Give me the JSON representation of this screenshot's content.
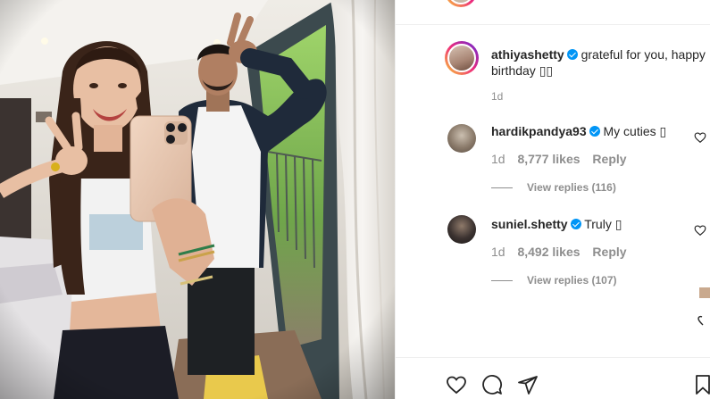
{
  "caption": {
    "username": "athiyashetty",
    "text_line1": "grateful for you, happy",
    "text_line2": "birthday ▯▯",
    "time": "1d"
  },
  "comments": [
    {
      "username": "hardikpandya93",
      "text": "My cuties ▯",
      "time": "1d",
      "likes": "8,777 likes",
      "reply_label": "Reply",
      "view_replies": "View replies (116)"
    },
    {
      "username": "suniel.shetty",
      "text": "Truly ▯",
      "time": "1d",
      "likes": "8,492 likes",
      "reply_label": "Reply",
      "view_replies": "View replies (107)"
    }
  ],
  "icons": {
    "verified": "verified-badge-icon",
    "like": "heart-icon",
    "comment": "comment-bubble-icon",
    "share": "paper-plane-icon",
    "save": "bookmark-icon"
  },
  "colors": {
    "verified": "#0095f6",
    "text": "#262626",
    "muted": "#8e8e8e"
  }
}
